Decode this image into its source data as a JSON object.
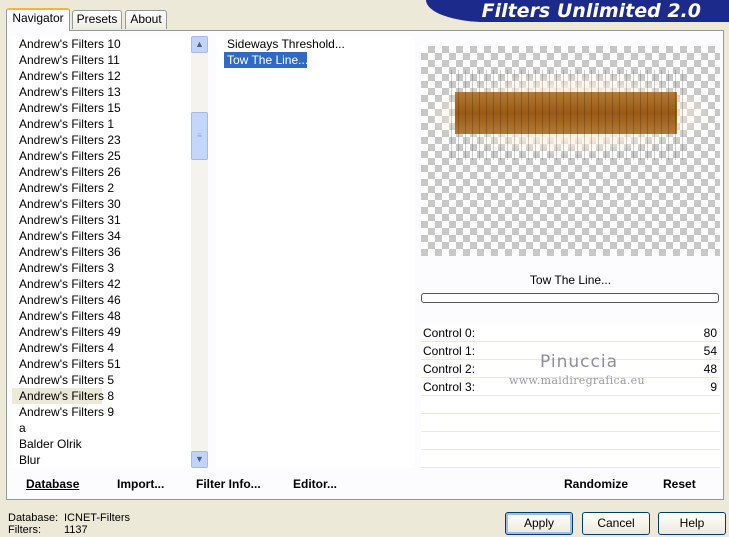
{
  "banner": {
    "title": "Filters Unlimited 2.0"
  },
  "tabs": [
    {
      "label": "Navigator"
    },
    {
      "label": "Presets"
    },
    {
      "label": "About"
    }
  ],
  "categories": {
    "selected": "Andrew's Filters 8",
    "items": [
      "Andrew's Filters 10",
      "Andrew's Filters 11",
      "Andrew's Filters 12",
      "Andrew's Filters 13",
      "Andrew's Filters 15",
      "Andrew's Filters 1",
      "Andrew's Filters 23",
      "Andrew's Filters 25",
      "Andrew's Filters 26",
      "Andrew's Filters 2",
      "Andrew's Filters 30",
      "Andrew's Filters 31",
      "Andrew's Filters 34",
      "Andrew's Filters 36",
      "Andrew's Filters 3",
      "Andrew's Filters 42",
      "Andrew's Filters 46",
      "Andrew's Filters 48",
      "Andrew's Filters 49",
      "Andrew's Filters 4",
      "Andrew's Filters 51",
      "Andrew's Filters 5",
      "Andrew's Filters 8",
      "Andrew's Filters 9",
      "a",
      "Balder Olrik",
      "Blur"
    ]
  },
  "filters": {
    "items": [
      "Sideways Threshold...",
      "Tow The Line..."
    ],
    "selected": "Tow The Line..."
  },
  "preview": {
    "filter_name": "Tow The Line..."
  },
  "controls": [
    {
      "label": "Control 0:",
      "value": "80"
    },
    {
      "label": "Control 1:",
      "value": "54"
    },
    {
      "label": "Control 2:",
      "value": "48"
    },
    {
      "label": "Control 3:",
      "value": "9"
    }
  ],
  "watermark": {
    "line1": "Pinuccia",
    "line2": "www.maidiregrafica.eu"
  },
  "panel_buttons": {
    "database": "Database",
    "import": "Import...",
    "filter_info": "Filter Info...",
    "editor": "Editor...",
    "randomize": "Randomize",
    "reset": "Reset"
  },
  "info": {
    "database_label": "Database:",
    "database_value": "ICNET-Filters",
    "filters_label": "Filters:",
    "filters_value": "1137"
  },
  "dialog_buttons": {
    "apply": "Apply",
    "cancel": "Cancel",
    "help": "Help"
  }
}
